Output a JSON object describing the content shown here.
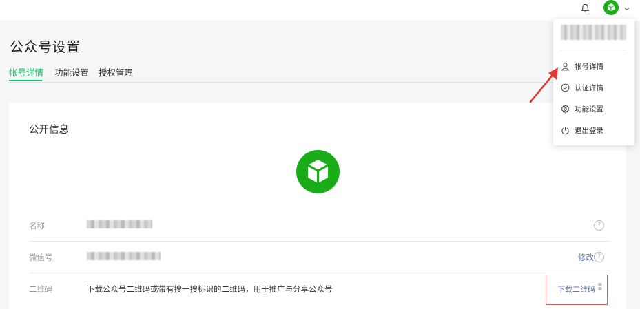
{
  "header": {
    "bell_icon": "bell-icon",
    "avatar_icon": "cube-avatar-icon",
    "caret_icon": "chevron-down-icon"
  },
  "page": {
    "title": "公众号设置"
  },
  "tabs": [
    {
      "label": "帐号详情",
      "active": true
    },
    {
      "label": "功能设置",
      "active": false
    },
    {
      "label": "授权管理",
      "active": false
    }
  ],
  "public_info": {
    "title": "公开信息",
    "rows": [
      {
        "label": "名称",
        "value": ""
      },
      {
        "label": "微信号",
        "value": "",
        "action": "修改"
      },
      {
        "label": "二维码",
        "value": "下载公众号二维码或带有搜一搜标识的二维码，用于推广与分享公众号",
        "action": "下载二维码"
      }
    ]
  },
  "dropdown": {
    "items": [
      {
        "label": "帐号详情",
        "icon": "user-icon"
      },
      {
        "label": "认证详情",
        "icon": "check-circle-icon"
      },
      {
        "label": "功能设置",
        "icon": "gear-icon"
      },
      {
        "label": "退出登录",
        "icon": "power-icon"
      }
    ]
  },
  "colors": {
    "brand_green": "#07c160",
    "link_blue": "#576b95",
    "annotation_red": "#e53935"
  }
}
